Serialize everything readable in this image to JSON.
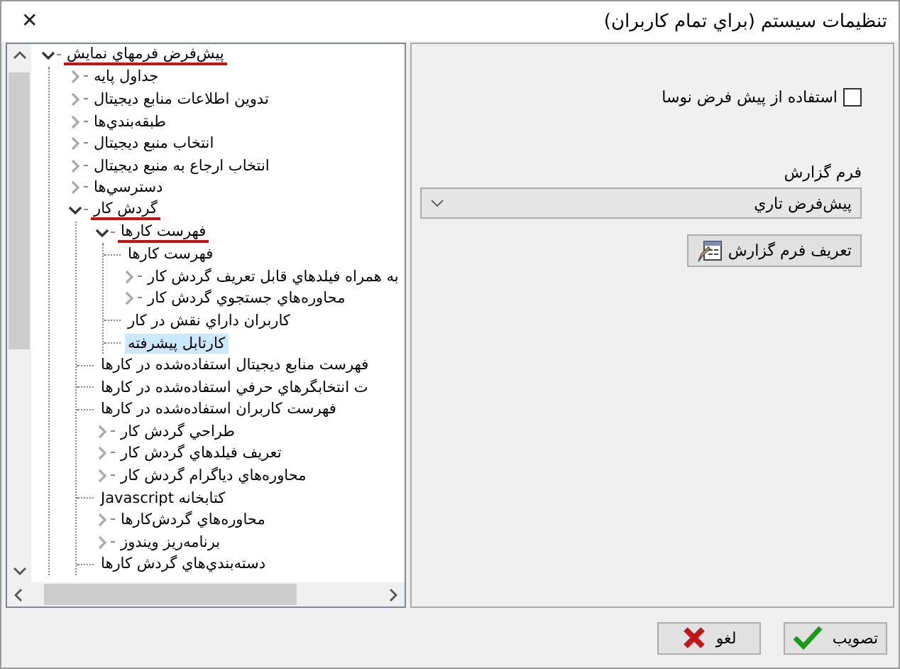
{
  "window": {
    "title": "تنظيمات سيستم (براي تمام کاربران)",
    "close_icon": "✕"
  },
  "tree": {
    "items": [
      {
        "label": "پيش‌فرض فرمهاي نمايش",
        "kind": "branch",
        "expanded": true,
        "selected": false,
        "marked": true,
        "children": [
          {
            "label": "جداول پايه",
            "kind": "branch",
            "expanded": false,
            "selected": false,
            "marked": false
          },
          {
            "label": "تدوين اطلاعات منابع ديجيتال",
            "kind": "branch",
            "expanded": false,
            "selected": false,
            "marked": false
          },
          {
            "label": "طبقه‌بندي‌ها",
            "kind": "branch",
            "expanded": false,
            "selected": false,
            "marked": false
          },
          {
            "label": "انتخاب منبع ديجيتال",
            "kind": "branch",
            "expanded": false,
            "selected": false,
            "marked": false
          },
          {
            "label": "انتخاب ارجاع به منبع ديجيتال",
            "kind": "branch",
            "expanded": false,
            "selected": false,
            "marked": false
          },
          {
            "label": "دسترسي‌ها",
            "kind": "branch",
            "expanded": false,
            "selected": false,
            "marked": false
          },
          {
            "label": "گردش کار",
            "kind": "branch",
            "expanded": true,
            "selected": false,
            "marked": true,
            "children": [
              {
                "label": "فهرست کارها",
                "kind": "branch",
                "expanded": true,
                "selected": false,
                "marked": true,
                "children": [
                  {
                    "label": "فهرست کارها",
                    "kind": "leaf",
                    "selected": false,
                    "marked": false
                  },
                  {
                    "label": "به همراه فيلدهاي قابل تعريف گردش کار",
                    "kind": "branch",
                    "expanded": false,
                    "selected": false,
                    "marked": false
                  },
                  {
                    "label": "محاوره‌هاي جستجوي گردش کار",
                    "kind": "branch",
                    "expanded": false,
                    "selected": false,
                    "marked": false
                  },
                  {
                    "label": "کاربران داراي نقش در کار",
                    "kind": "leaf",
                    "selected": false,
                    "marked": false
                  },
                  {
                    "label": "کارتابل پيشرفته",
                    "kind": "leaf",
                    "selected": true,
                    "marked": false
                  }
                ]
              },
              {
                "label": "فهرست منابع ديجيتال استفاده‌شده در کارها",
                "kind": "leaf",
                "selected": false,
                "marked": false
              },
              {
                "label": "ت انتخابگرهاي حرفي استفاده‌شده در کارها",
                "kind": "leaf",
                "selected": false,
                "marked": false
              },
              {
                "label": "فهرست کاربران استفاده‌شده در کارها",
                "kind": "leaf",
                "selected": false,
                "marked": false
              },
              {
                "label": "طراحي گردش کار",
                "kind": "branch",
                "expanded": false,
                "selected": false,
                "marked": false
              },
              {
                "label": "تعريف فيلدهاي گردش کار",
                "kind": "branch",
                "expanded": false,
                "selected": false,
                "marked": false
              },
              {
                "label": "محاوره‌هاي دياگرام گردش کار",
                "kind": "branch",
                "expanded": false,
                "selected": false,
                "marked": false
              },
              {
                "label": "کتابخانه Javascript",
                "kind": "leaf",
                "selected": false,
                "marked": false
              },
              {
                "label": "محاوره‌هاي گردش‌کارها",
                "kind": "branch",
                "expanded": false,
                "selected": false,
                "marked": false
              },
              {
                "label": "برنامه‌ريز ويندوز",
                "kind": "branch",
                "expanded": false,
                "selected": false,
                "marked": false
              },
              {
                "label": "دسته‌بندي‌هاي گردش کارها",
                "kind": "leaf",
                "selected": false,
                "marked": false
              }
            ]
          }
        ]
      }
    ]
  },
  "settings": {
    "use_default": {
      "label": "استفاده از پيش فرض نوسا",
      "checked": false
    },
    "report_form": {
      "label": "فرم گزارش",
      "value": "پيش‌فرض تاري"
    },
    "define_button": "تعريف فرم گزارش"
  },
  "buttons": [
    {
      "kind": "ok",
      "label": "تصويب"
    },
    {
      "kind": "cancel",
      "label": "لغو"
    }
  ]
}
